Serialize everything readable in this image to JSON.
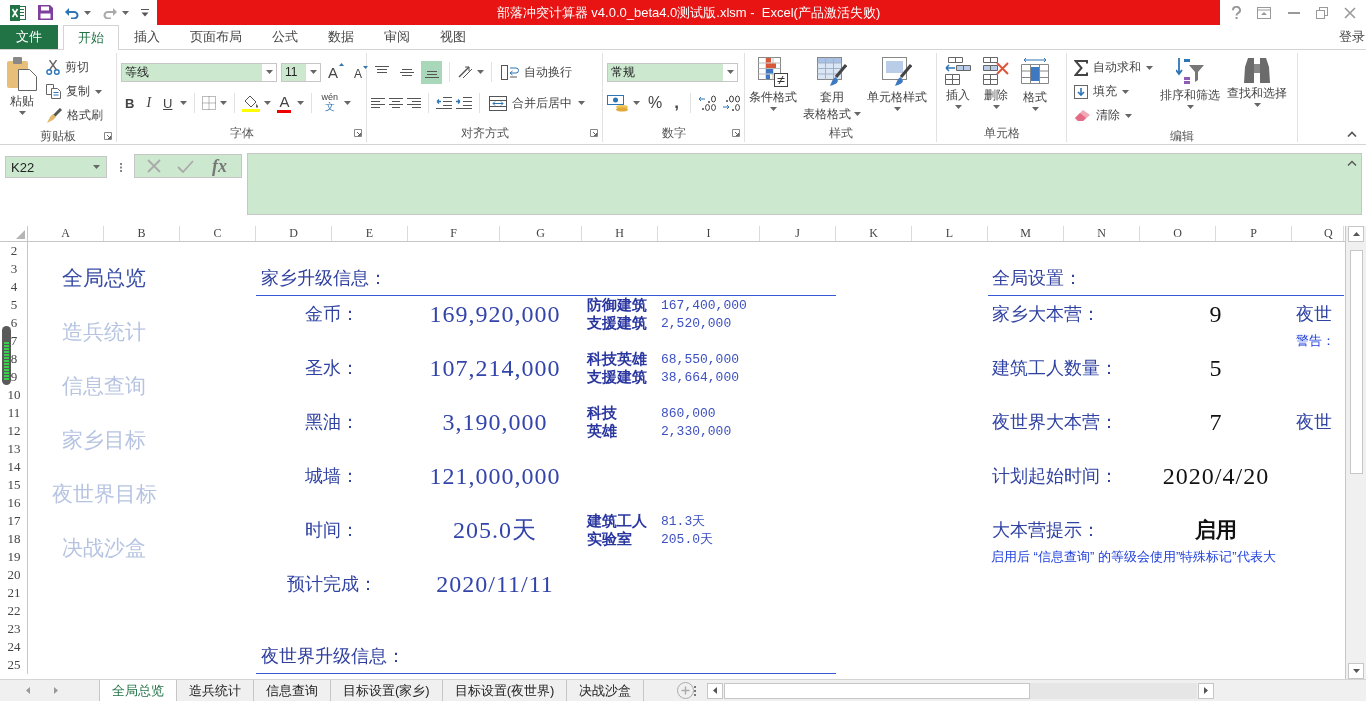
{
  "title_bar": {
    "title": "部落冲突计算器 v4.0.0_beta4.0测试版.xlsm -  Excel(产品激活失败)"
  },
  "ribbon": {
    "file_tab": "文件",
    "tabs": [
      {
        "label": "开始",
        "selected": true
      },
      {
        "label": "插入",
        "selected": false
      },
      {
        "label": "页面布局",
        "selected": false
      },
      {
        "label": "公式",
        "selected": false
      },
      {
        "label": "数据",
        "selected": false
      },
      {
        "label": "审阅",
        "selected": false
      },
      {
        "label": "视图",
        "selected": false
      }
    ],
    "sign_in": "登录",
    "clipboard": {
      "label": "剪贴板",
      "paste": "粘贴",
      "cut": "剪切",
      "copy": "复制",
      "format_painter": "格式刷"
    },
    "font": {
      "label": "字体",
      "font_name": "等线",
      "font_size": "11",
      "grow": "A",
      "shrink": "A",
      "bold": "B",
      "italic": "I",
      "underline": "U",
      "font_color": "A",
      "phonetic": [
        "wén",
        "文"
      ]
    },
    "alignment": {
      "label": "对齐方式",
      "vertical": [
        {
          "selected": false
        },
        {
          "selected": false
        },
        {
          "selected": true
        }
      ],
      "wrap_text": "自动换行",
      "merge_center": "合并后居中"
    },
    "number": {
      "label": "数字",
      "format": "常规",
      "percent": "%",
      "comma": ","
    },
    "styles": {
      "label": "样式",
      "buttons": [
        [
          "条件格式"
        ],
        [
          "套用",
          "表格格式"
        ],
        [
          "单元格样式"
        ]
      ]
    },
    "cells": {
      "label": "单元格",
      "buttons": [
        "插入",
        "删除",
        "格式"
      ]
    },
    "editing": {
      "label": "编辑",
      "autosum": "自动求和",
      "fill": "填充",
      "clear": "清除",
      "sort_filter": "排序和筛选",
      "find_select": "查找和选择"
    }
  },
  "formula_bar": {
    "name_box": "K22",
    "function_button": "fx"
  },
  "columns": [
    "A",
    "B",
    "C",
    "D",
    "E",
    "F",
    "G",
    "H",
    "I",
    "J",
    "K",
    "L",
    "M",
    "N",
    "O",
    "P",
    "Q"
  ],
  "rows": [
    "2",
    "3",
    "4",
    "5",
    "6",
    "7",
    "8",
    "9",
    "10",
    "11",
    "12",
    "13",
    "14",
    "15",
    "16",
    "17",
    "18",
    "19",
    "20",
    "21",
    "22",
    "23",
    "24",
    "25"
  ],
  "nav": [
    {
      "label": "全局总览",
      "selected": true
    },
    {
      "label": "造兵统计",
      "selected": false
    },
    {
      "label": "信息查询",
      "selected": false
    },
    {
      "label": "家乡目标",
      "selected": false
    },
    {
      "label": "夜世界目标",
      "selected": false
    },
    {
      "label": "决战沙盒",
      "selected": false
    }
  ],
  "home_upgrade": {
    "title": "家乡升级信息：",
    "rows": [
      {
        "label": "金币：",
        "value": "169,920,000",
        "details": [
          {
            "name": "防御建筑",
            "value": "167,400,000"
          },
          {
            "name": "支援建筑",
            "value": "2,520,000"
          }
        ]
      },
      {
        "label": "圣水：",
        "value": "107,214,000",
        "details": [
          {
            "name": "科技英雄",
            "value": "68,550,000"
          },
          {
            "name": "支援建筑",
            "value": "38,664,000"
          }
        ]
      },
      {
        "label": "黑油：",
        "value": "3,190,000",
        "details": [
          {
            "name": "科技",
            "value": "860,000"
          },
          {
            "name": "英雄",
            "value": "2,330,000"
          }
        ]
      },
      {
        "label": "城墙：",
        "value": "121,000,000"
      },
      {
        "label": "时间：",
        "value": "205.0天",
        "details": [
          {
            "name": "建筑工人",
            "value": "81.3天"
          },
          {
            "name": "实验室",
            "value": "205.0天"
          }
        ]
      },
      {
        "label": "预计完成：",
        "value": "2020/11/11"
      }
    ]
  },
  "night_upgrade": {
    "title": "夜世界升级信息："
  },
  "global_settings": {
    "title": "全局设置：",
    "rows": [
      {
        "label": "家乡大本营：",
        "value": "9",
        "side": "夜世",
        "side_note": "警告："
      },
      {
        "label": "建筑工人数量：",
        "value": "5"
      },
      {
        "label": "夜世界大本营：",
        "value": "7",
        "side": "夜世"
      },
      {
        "label": "计划起始时间：",
        "value": "2020/4/20"
      },
      {
        "label": "大本营提示：",
        "value": "启用",
        "note": "启用后 “信息查询” 的等级会使用”特殊标记”代表大"
      }
    ]
  },
  "sheet_tabs": [
    {
      "label": "全局总览",
      "selected": true
    },
    {
      "label": "造兵统计",
      "selected": false
    },
    {
      "label": "信息查询",
      "selected": false
    },
    {
      "label": "目标设置(家乡)",
      "selected": false
    },
    {
      "label": "目标设置(夜世界)",
      "selected": false
    },
    {
      "label": "决战沙盒",
      "selected": false
    }
  ]
}
